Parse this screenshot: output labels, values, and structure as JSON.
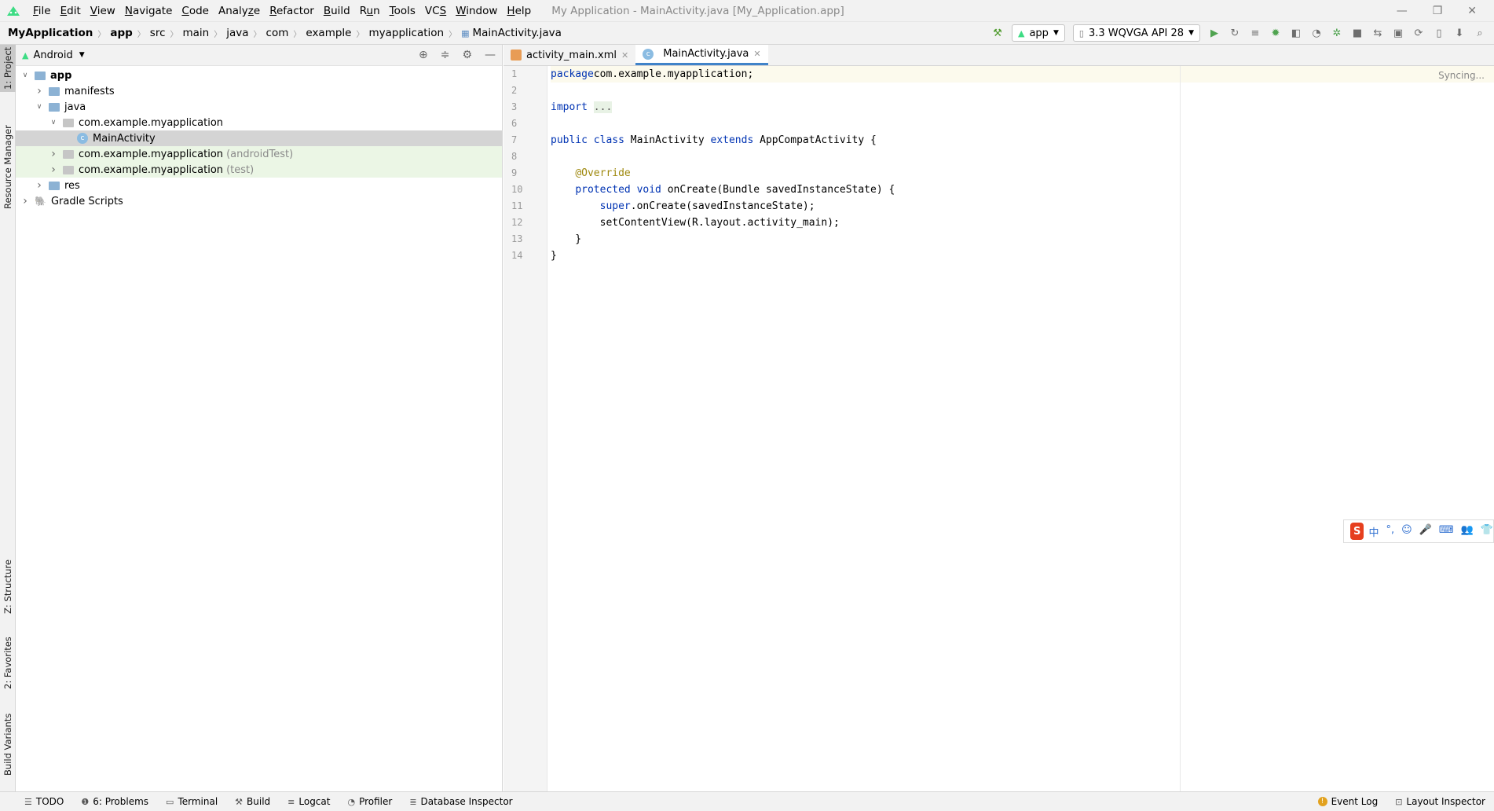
{
  "menu": {
    "items": [
      {
        "label": "File",
        "u": "F"
      },
      {
        "label": "Edit",
        "u": "E"
      },
      {
        "label": "View",
        "u": "V"
      },
      {
        "label": "Navigate",
        "u": "N"
      },
      {
        "label": "Code",
        "u": "C"
      },
      {
        "label": "Analyze",
        "u": "z"
      },
      {
        "label": "Refactor",
        "u": "R"
      },
      {
        "label": "Build",
        "u": "B"
      },
      {
        "label": "Run",
        "u": "u"
      },
      {
        "label": "Tools",
        "u": "T"
      },
      {
        "label": "VCS",
        "u": "S"
      },
      {
        "label": "Window",
        "u": "W"
      },
      {
        "label": "Help",
        "u": "H"
      }
    ],
    "window_title": "My Application - MainActivity.java [My_Application.app]"
  },
  "breadcrumb": [
    "MyApplication",
    "app",
    "src",
    "main",
    "java",
    "com",
    "example",
    "myapplication",
    "MainActivity.java"
  ],
  "toolbar": {
    "run_config": "app",
    "device": "3.3  WQVGA API 28"
  },
  "side_tabs": {
    "project": "1: Project",
    "resource_manager": "Resource Manager",
    "structure": "Z: Structure",
    "favorites": "2: Favorites",
    "build_variants": "Build Variants"
  },
  "project": {
    "view_mode": "Android",
    "tree": [
      {
        "label": "app",
        "depth": 0,
        "expanded": true,
        "bold": true,
        "icon": "module-folder-icon"
      },
      {
        "label": "manifests",
        "depth": 1,
        "expanded": false,
        "icon": "folder-icon"
      },
      {
        "label": "java",
        "depth": 1,
        "expanded": true,
        "icon": "folder-icon"
      },
      {
        "label": "com.example.myapplication",
        "depth": 2,
        "expanded": true,
        "icon": "package-icon"
      },
      {
        "label": "MainActivity",
        "depth": 3,
        "icon": "class-icon",
        "selected": true
      },
      {
        "label": "com.example.myapplication",
        "suffix": "(androidTest)",
        "depth": 2,
        "expanded": false,
        "icon": "package-icon",
        "test": true
      },
      {
        "label": "com.example.myapplication",
        "suffix": "(test)",
        "depth": 2,
        "expanded": false,
        "icon": "package-icon",
        "test": true
      },
      {
        "label": "res",
        "depth": 1,
        "expanded": false,
        "icon": "folder-icon"
      },
      {
        "label": "Gradle Scripts",
        "depth": 0,
        "expanded": false,
        "icon": "gradle-icon"
      }
    ]
  },
  "editor": {
    "tabs": [
      {
        "label": "activity_main.xml",
        "active": false
      },
      {
        "label": "MainActivity.java",
        "active": true
      }
    ],
    "status": "Syncing...",
    "lines": [
      {
        "n": "1",
        "parts": [
          [
            "kw",
            "package"
          ],
          [
            "",
            "com.example.myapplication;"
          ]
        ]
      },
      {
        "n": "2",
        "parts": []
      },
      {
        "n": "3",
        "parts": [
          [
            "kw",
            "import"
          ],
          [
            "",
            " "
          ],
          [
            "fold",
            "..."
          ]
        ]
      },
      {
        "n": "6",
        "parts": []
      },
      {
        "n": "7",
        "parts": [
          [
            "kw",
            "public class"
          ],
          [
            "",
            " MainActivity "
          ],
          [
            "kw",
            "extends"
          ],
          [
            "",
            " AppCompatActivity {"
          ]
        ]
      },
      {
        "n": "8",
        "parts": []
      },
      {
        "n": "9",
        "parts": [
          [
            "",
            "    "
          ],
          [
            "an",
            "@Override"
          ]
        ]
      },
      {
        "n": "10",
        "parts": [
          [
            "",
            "    "
          ],
          [
            "kw",
            "protected void"
          ],
          [
            "",
            " onCreate(Bundle savedInstanceState) {"
          ]
        ]
      },
      {
        "n": "11",
        "parts": [
          [
            "",
            "        "
          ],
          [
            "kw",
            "super"
          ],
          [
            "",
            ".onCreate(savedInstanceState);"
          ]
        ]
      },
      {
        "n": "12",
        "parts": [
          [
            "",
            "        setContentView(R.layout.activity_main);"
          ]
        ]
      },
      {
        "n": "13",
        "parts": [
          [
            "",
            "    }"
          ]
        ]
      },
      {
        "n": "14",
        "parts": [
          [
            "",
            "}"
          ]
        ]
      }
    ]
  },
  "ime": {
    "items": [
      "中",
      "°,",
      "☺",
      "🎤",
      "⌨",
      "👥",
      "👕"
    ]
  },
  "statusbar": {
    "left": [
      {
        "label": "TODO",
        "icon": "list-icon"
      },
      {
        "label": "6: Problems",
        "icon": "problems-icon"
      },
      {
        "label": "Terminal",
        "icon": "terminal-icon"
      },
      {
        "label": "Build",
        "icon": "hammer-icon"
      },
      {
        "label": "Logcat",
        "icon": "logcat-icon"
      },
      {
        "label": "Profiler",
        "icon": "profiler-icon"
      },
      {
        "label": "Database Inspector",
        "icon": "database-icon"
      }
    ],
    "right": [
      {
        "label": "Event Log",
        "icon": "event-log-icon"
      },
      {
        "label": "Layout Inspector",
        "icon": "layout-inspector-icon"
      }
    ]
  }
}
